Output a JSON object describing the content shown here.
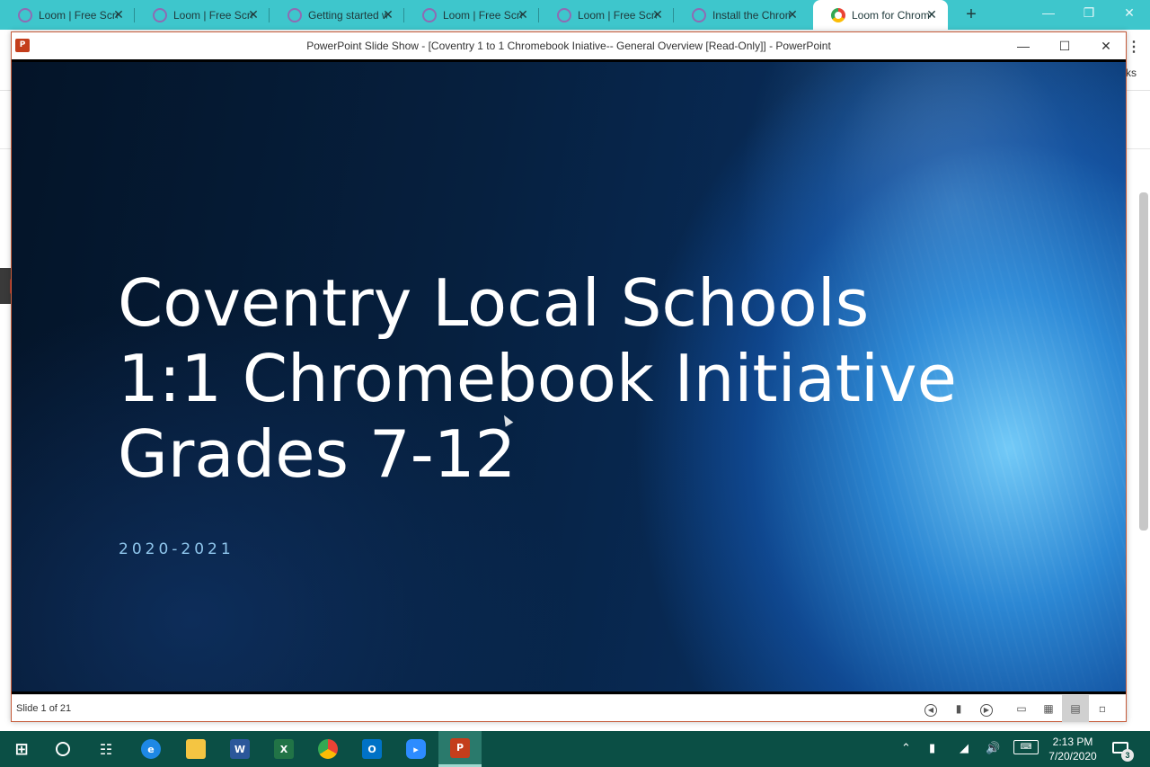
{
  "browser": {
    "tabs": [
      {
        "title": "Loom | Free Screen"
      },
      {
        "title": "Loom | Free Screen"
      },
      {
        "title": "Getting started with"
      },
      {
        "title": "Loom | Free Screen"
      },
      {
        "title": "Loom | Free Screen"
      },
      {
        "title": "Install the Chrome"
      },
      {
        "title": "Loom for Chrome"
      }
    ],
    "active_tab_index": 6,
    "new_tab_symbol": "+",
    "tab_close_symbol": "✕",
    "bookmarks_fragment": "ks",
    "accent_color": "#3ec6cc"
  },
  "powerpoint": {
    "window_title": "PowerPoint Slide Show - [Coventry 1 to 1 Chromebook Iniative-- General Overview [Read-Only]] - PowerPoint",
    "app_icon_letter": "P",
    "slide": {
      "title_lines": [
        "Coventry Local Schools",
        "1:1 Chromebook Initiative",
        "Grades 7-12"
      ],
      "subtitle": "2020-2021"
    },
    "status": {
      "slide_counter": "Slide 1 of 21"
    }
  },
  "taskbar": {
    "clock_time": "2:13 PM",
    "clock_date": "7/20/2020",
    "notification_count": "3",
    "color": "#0b4f45"
  }
}
